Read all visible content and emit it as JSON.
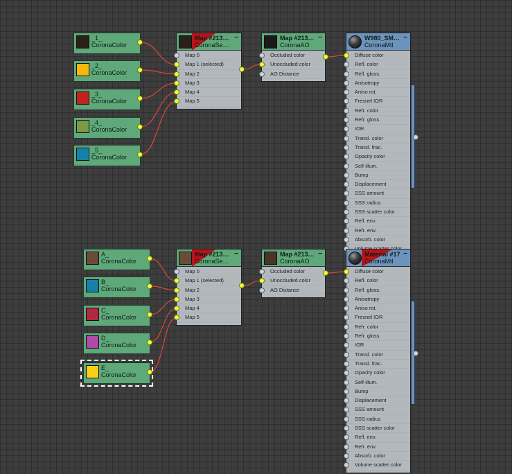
{
  "group1": {
    "color_nodes": [
      {
        "label": "_1_",
        "type": "CoronaColor",
        "color": "#2a2118"
      },
      {
        "label": "_2_",
        "type": "CoronaColor",
        "color": "#f5b80c"
      },
      {
        "label": "_3_",
        "type": "CoronaColor",
        "color": "#c0231e"
      },
      {
        "label": "_4_",
        "type": "CoronaColor",
        "color": "#7a9a45"
      },
      {
        "label": "_5_",
        "type": "CoronaColor",
        "color": "#1581a8"
      }
    ],
    "select_node": {
      "title": "Map #213…",
      "subtitle": "CoronaSe…",
      "color": "#2a2118",
      "slots": [
        "Map 0",
        "Map 1 (selected)",
        "Map 2",
        "Map 3",
        "Map 4",
        "Map 5"
      ]
    },
    "ao_node": {
      "title": "Map #213…",
      "subtitle": "CoronaAO",
      "color": "#1a1a18",
      "slots": [
        "Occluded color",
        "Unoccluded color",
        "AO Distance"
      ]
    },
    "mtl_node": {
      "title": "W980_SM…",
      "subtitle": "CoronaMtl"
    }
  },
  "group2": {
    "color_nodes": [
      {
        "label": "A_",
        "type": "CoronaColor",
        "color": "#6b4a3a"
      },
      {
        "label": "B_",
        "type": "CoronaColor",
        "color": "#1581a8"
      },
      {
        "label": "C_",
        "type": "CoronaColor",
        "color": "#b32840"
      },
      {
        "label": "D_",
        "type": "CoronaColor",
        "color": "#b04aa8"
      },
      {
        "label": "E_",
        "type": "CoronaColor",
        "color": "#f9d016"
      }
    ],
    "select_node": {
      "title": "Map #213…",
      "subtitle": "CoronaSe…",
      "color": "#6b4a3a",
      "slots": [
        "Map 0",
        "Map 1 (selected)",
        "Map 2",
        "Map 3",
        "Map 4",
        "Map 5"
      ]
    },
    "ao_node": {
      "title": "Map #213…",
      "subtitle": "CoronaAO",
      "color": "#4a3428",
      "slots": [
        "Occluded color",
        "Unoccluded color",
        "AO Distance"
      ]
    },
    "mtl_node": {
      "title": "Material #17",
      "subtitle": "CoronaMtl"
    }
  },
  "mtl_slots": [
    "Diffuse color",
    "Refl. color",
    "Refl. gloss.",
    "Anisotropy",
    "Aniso rot.",
    "Fresnel IOR",
    "Refr. color",
    "Refr. gloss.",
    "IOR",
    "Transl. color",
    "Transl. frac.",
    "Opacity color",
    "Self-illum.",
    "Bump",
    "Displacement",
    "SSS amount",
    "SSS radius",
    "SSS scatter color",
    "Refl. env.",
    "Refr. env.",
    "Absorb. color",
    "Volume scatter color"
  ],
  "icons": {
    "minimize": "minus-icon",
    "material_preview": "sphere-icon"
  },
  "colors": {
    "wire": "#e0443c",
    "port_active": "#e8ff3a",
    "node_green": "#5fa87a",
    "node_blue": "#6b93bc",
    "slot_bg": "#b3b8bd"
  }
}
